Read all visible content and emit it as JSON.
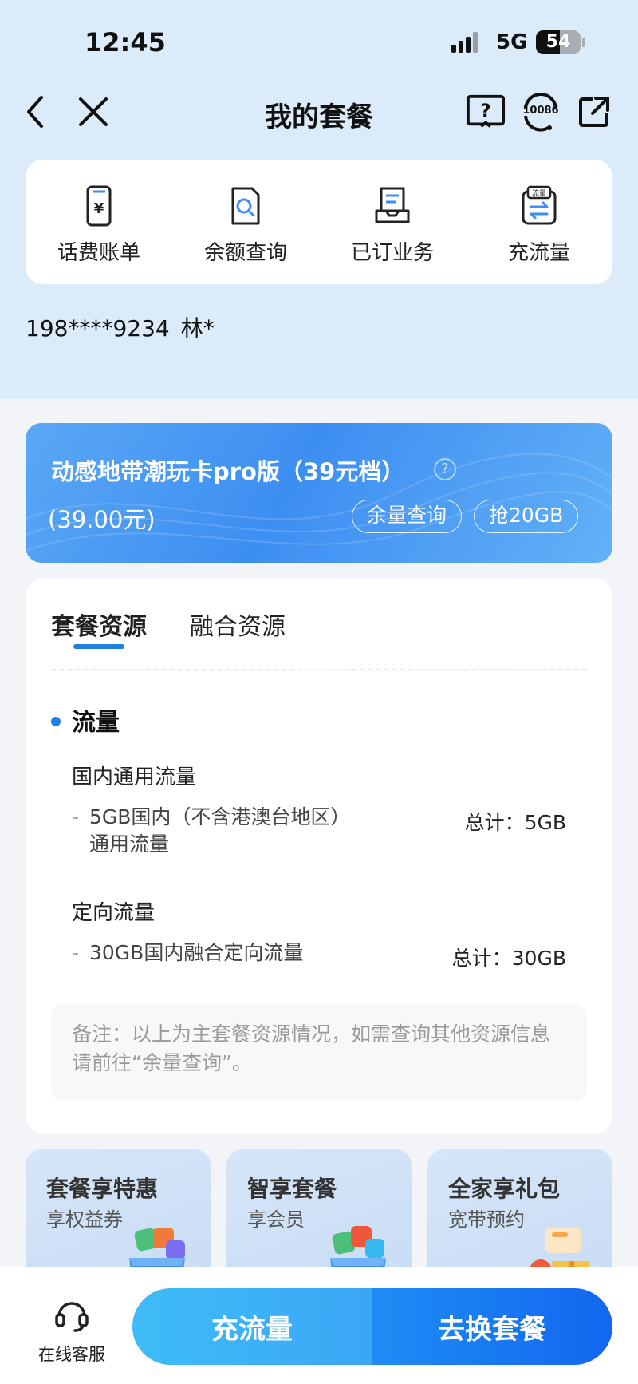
{
  "status_bar": {
    "time": "12:45",
    "network": "5G",
    "battery": "54",
    "battery_level": 0.54
  },
  "nav": {
    "title": "我的套餐",
    "service_number": "10086"
  },
  "quick_menu": [
    {
      "label": "话费账单",
      "icon": "bill-icon"
    },
    {
      "label": "余额查询",
      "icon": "balance-search-icon"
    },
    {
      "label": "已订业务",
      "icon": "subscribed-services-icon"
    },
    {
      "label": "充流量",
      "icon": "data-recharge-icon",
      "badge": "流量"
    }
  ],
  "account": {
    "phone": "198****9234",
    "name": "林*"
  },
  "plan": {
    "name": "动感地带潮玩卡pro版（39元档）",
    "price": "(39.00元)",
    "balance_button": "余量查询",
    "grab_button": "抢20GB"
  },
  "resources": {
    "tabs": [
      {
        "label": "套餐资源",
        "active": true
      },
      {
        "label": "融合资源",
        "active": false
      }
    ],
    "section_title": "流量",
    "groups": [
      {
        "title": "国内通用流量",
        "item_desc": "5GB国内（不含港澳台地区）通用流量",
        "item_total": "总计：5GB"
      },
      {
        "title": "定向流量",
        "item_desc": "30GB国内融合定向流量",
        "item_total": "总计：30GB"
      }
    ],
    "note": "备注：以上为主套餐资源情况，如需查询其他资源信息请前往“余量查询”。"
  },
  "promos": [
    {
      "title": "套餐享特惠",
      "subtitle": "享权益券"
    },
    {
      "title": "智享套餐",
      "subtitle": "享会员"
    },
    {
      "title": "全家享礼包",
      "subtitle": "宽带预约"
    }
  ],
  "bottom_bar": {
    "service_label": "在线客服",
    "recharge_button": "充流量",
    "change_plan_button": "去换套餐"
  },
  "colors": {
    "accent": "#1f7fe8",
    "header_bg": "#dcebfa",
    "banner": "#3d8ef2"
  }
}
